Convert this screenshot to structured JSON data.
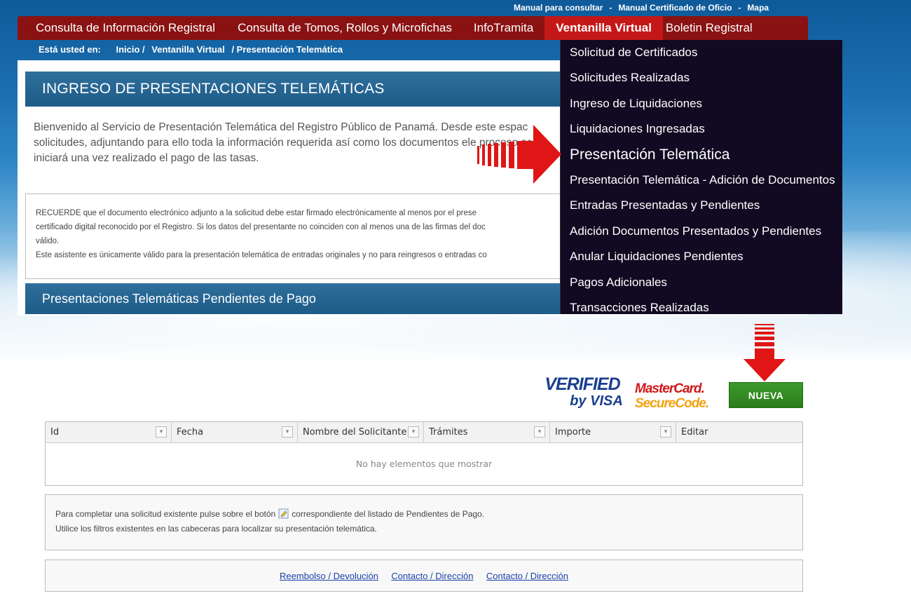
{
  "top_links": {
    "manual": "Manual para consultar",
    "manual_cert": "Manual Certificado de Oficio",
    "mapa": "Mapa",
    "sep": "-"
  },
  "nav": {
    "items": [
      "Consulta de Información Registral",
      "Consulta de Tomos, Rollos y Microfichas",
      "InfoTramita",
      "Ventanilla Virtual",
      "Boletin Registral"
    ]
  },
  "breadcrumb": {
    "prefix": "Está usted en:",
    "inicio": "Inicio /",
    "ventanilla": "Ventanilla Virtual",
    "current": "/ Presentación Telemática"
  },
  "page_title": "INGRESO DE PRESENTACIONES TELEMÁTICAS",
  "intro_text": "Bienvenido al Servicio de Presentación Telemática del Registro Público de Panamá. Desde este espac solicitudes, adjuntando para ello toda la información requerida así como los documentos ele proceso se iniciará una vez realizado el pago de las tasas.",
  "notice": {
    "line1": "RECUERDE que el documento electrónico adjunto a la solicitud debe estar firmado electrónicamente al menos por el prese",
    "line2": "certificado digital reconocido por el Registro. Si los datos del presentante no coinciden con al menos una de las firmas del doc",
    "line3": "válido.",
    "line4": "Este asistente es únicamente válido para la presentación telemática de entradas originales y no para reingresos o entradas co"
  },
  "pending_title": "Presentaciones Telemáticas Pendientes de Pago",
  "dropdown": {
    "items": [
      "Solicitud de Certificados",
      "Solicitudes Realizadas",
      "Ingreso de Liquidaciones",
      "Liquidaciones Ingresadas",
      "Presentación Telemática",
      "Presentación Telemática - Adición de Documentos",
      "Entradas Presentadas y Pendientes",
      "Adición Documentos Presentados y Pendientes",
      "Anular Liquidaciones Pendientes",
      "Pagos Adicionales",
      "Transacciones Realizadas"
    ]
  },
  "badges": {
    "visa_line1": "VERIFIED",
    "visa_line2": "by VISA",
    "mc_line1": "MasterCard.",
    "mc_line2": "SecureCode."
  },
  "nueva_button": "NUEVA",
  "grid": {
    "columns": [
      "Id",
      "Fecha",
      "Nombre del Solicitante",
      "Trámites",
      "Importe",
      "Editar"
    ],
    "filter_glyph": "▾",
    "empty": "No hay elementos que mostrar"
  },
  "help": {
    "line1_a": "Para completar una solicitud existente pulse sobre el botón",
    "line1_b": "correspondiente del listado de Pendientes de Pago.",
    "line2": "Utilice los filtros existentes en las cabeceras para localizar su presentación telemática."
  },
  "footer_links": [
    "Reembolso / Devolución",
    "Contacto / Dirección",
    "Contacto / Dirección"
  ],
  "colors": {
    "nav_bg": "#8a1212",
    "nav_active": "#c41818",
    "dropdown_bg": "#110a22",
    "title_bar": "#2f6f9c",
    "nueva_green": "#3c9a2a",
    "arrow_red": "#e01515",
    "link_blue": "#1a3fa8"
  }
}
